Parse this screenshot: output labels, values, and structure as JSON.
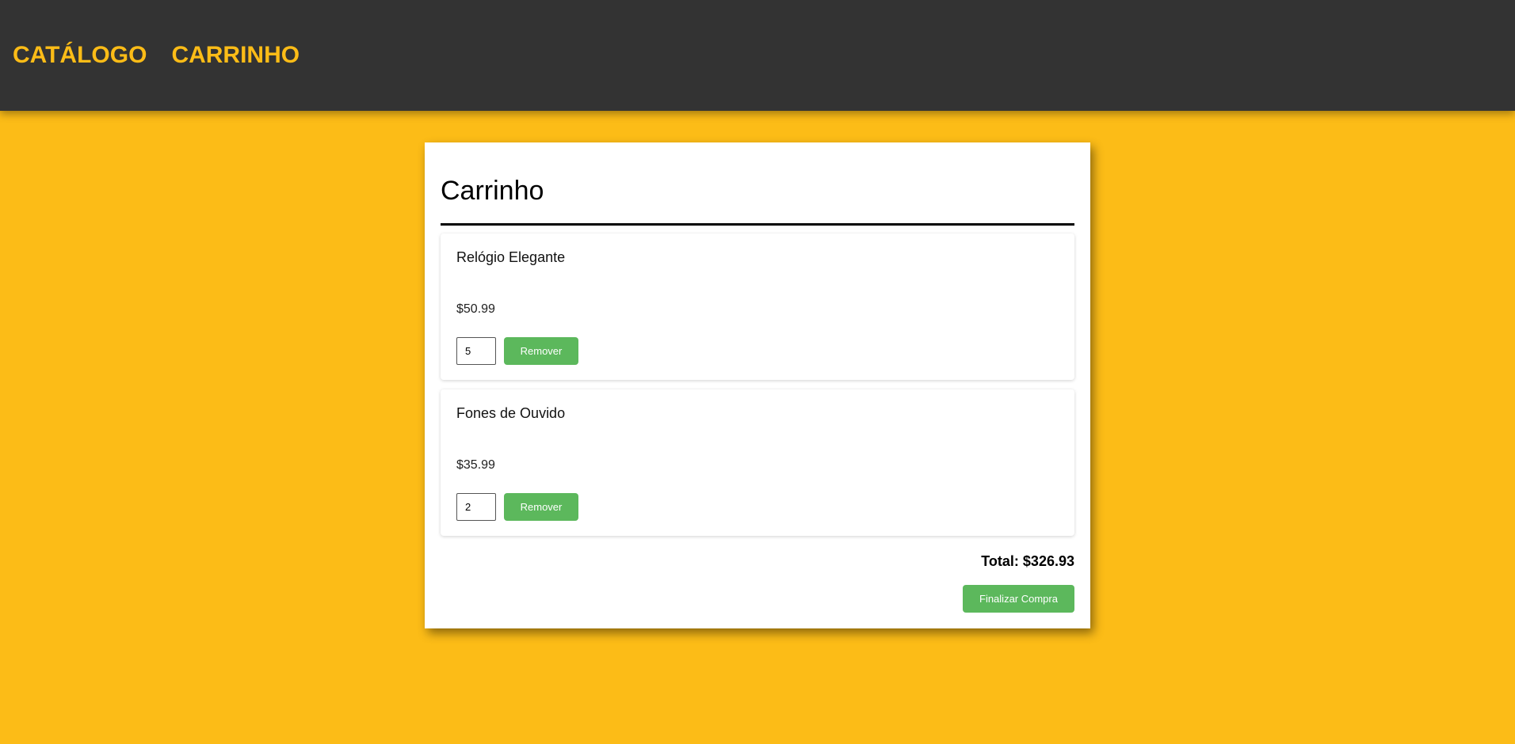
{
  "nav": {
    "catalog_label": "CATÁLOGO",
    "cart_label": "CARRINHO"
  },
  "cart": {
    "title": "Carrinho",
    "items": [
      {
        "name": "Relógio Elegante",
        "price": "$50.99",
        "quantity": "5",
        "remove_label": "Remover"
      },
      {
        "name": "Fones de Ouvido",
        "price": "$35.99",
        "quantity": "2",
        "remove_label": "Remover"
      }
    ],
    "total": "Total: $326.93",
    "checkout_label": "Finalizar Compra"
  },
  "colors": {
    "background": "#fcbc17",
    "header": "#333333",
    "accent_text": "#fcbc17",
    "button": "#5cb85c"
  }
}
